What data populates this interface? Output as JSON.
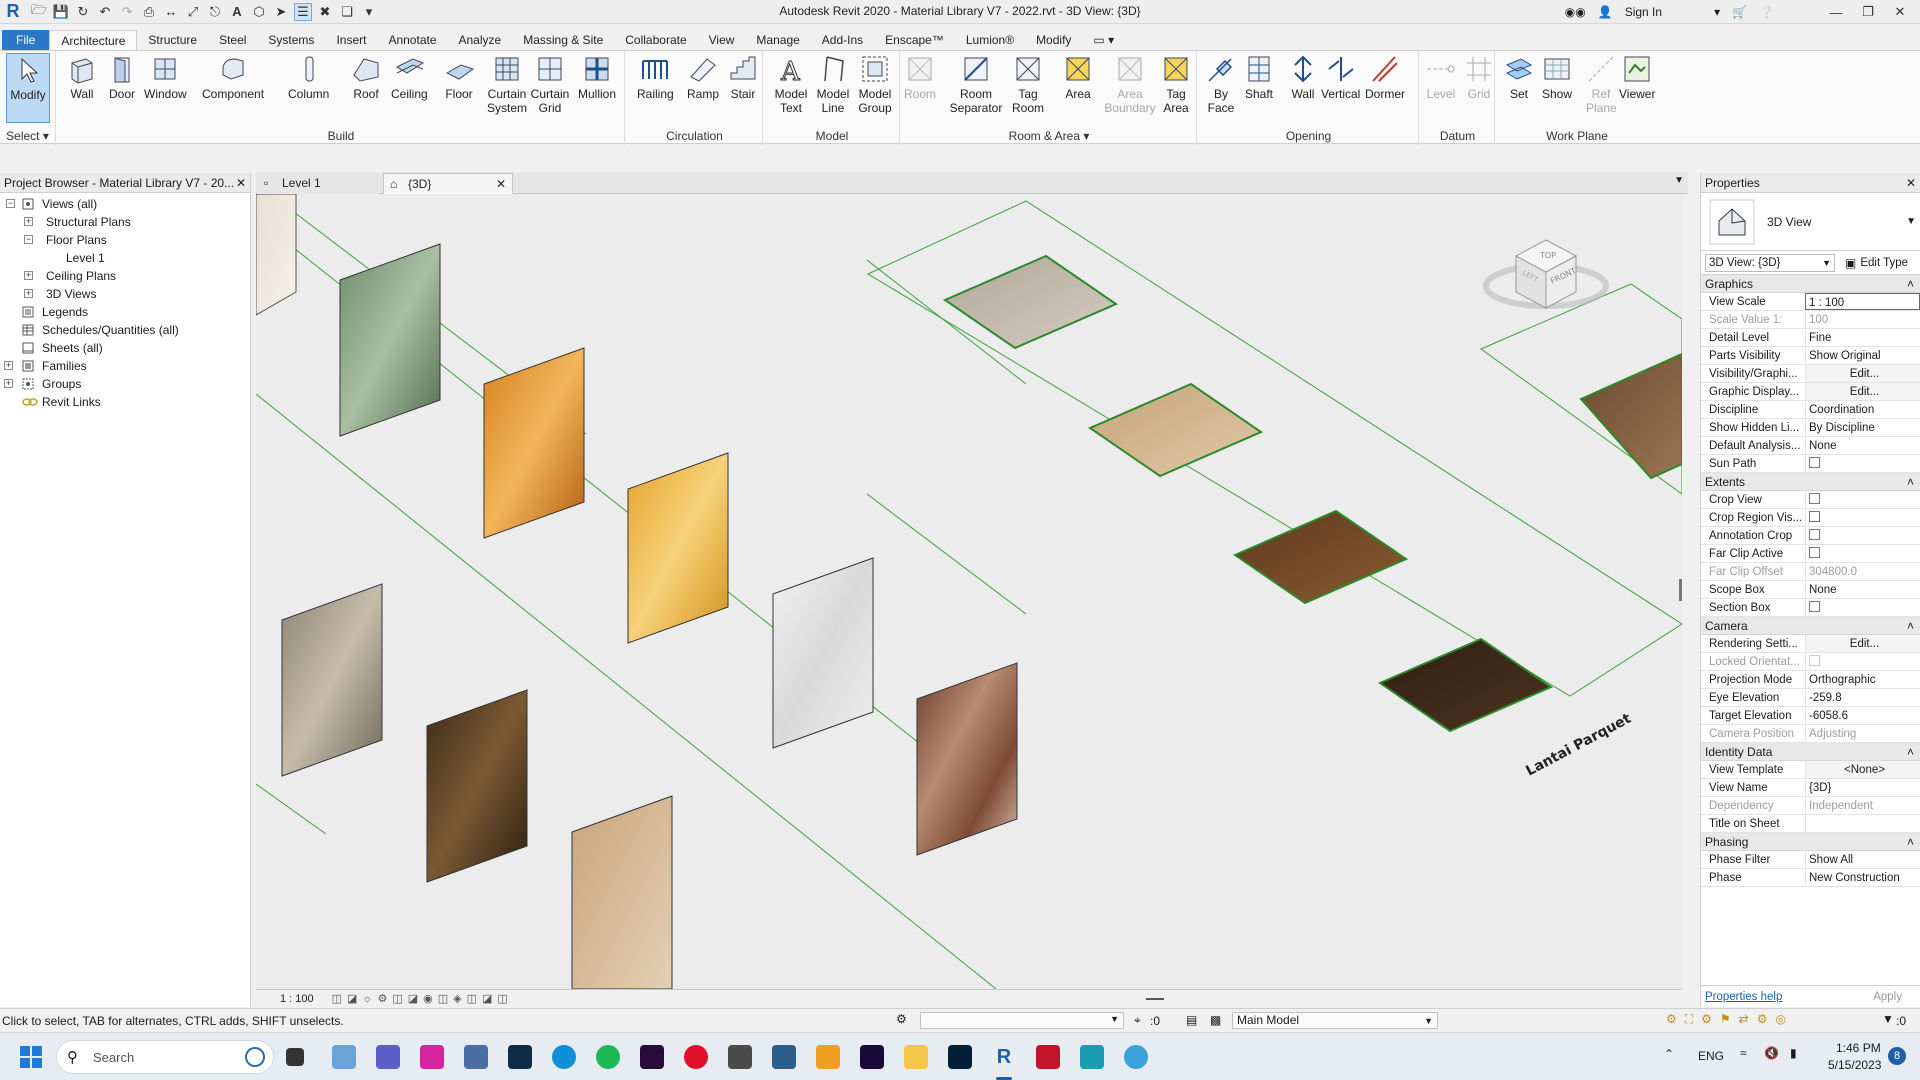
{
  "window": {
    "title": "Autodesk Revit 2020 - Material Library V7 - 2022.rvt - 3D View: {3D}",
    "sign_in": "Sign In"
  },
  "menu_tabs": [
    "File",
    "Architecture",
    "Structure",
    "Steel",
    "Systems",
    "Insert",
    "Annotate",
    "Analyze",
    "Massing & Site",
    "Collaborate",
    "View",
    "Manage",
    "Add-Ins",
    "Enscape™",
    "Lumion®",
    "Modify"
  ],
  "ribbon": {
    "select_label": "Select",
    "modify": "Modify",
    "build": {
      "label": "Build",
      "buttons": [
        "Wall",
        "Door",
        "Window",
        "Component",
        "Column",
        "Roof",
        "Ceiling",
        "Floor",
        "Curtain System",
        "Curtain Grid",
        "Mullion"
      ]
    },
    "circulation": {
      "label": "Circulation",
      "buttons": [
        "Railing",
        "Ramp",
        "Stair"
      ]
    },
    "model": {
      "label": "Model",
      "buttons": [
        "Model Text",
        "Model Line",
        "Model Group"
      ]
    },
    "room_area": {
      "label": "Room & Area",
      "buttons": [
        "Room",
        "Room Separator",
        "Tag Room",
        "Area",
        "Area Boundary",
        "Tag Area"
      ]
    },
    "opening": {
      "label": "Opening",
      "buttons": [
        "By Face",
        "Shaft",
        "Wall",
        "Vertical",
        "Dormer"
      ]
    },
    "datum": {
      "label": "Datum",
      "buttons": [
        "Level",
        "Grid"
      ]
    },
    "work_plane": {
      "label": "Work Plane",
      "buttons": [
        "Set",
        "Show",
        "Ref Plane",
        "Viewer"
      ]
    }
  },
  "project_browser": {
    "title": "Project Browser - Material Library V7 - 20...",
    "items": [
      "Views (all)",
      "Structural Plans",
      "Floor Plans",
      "Level 1",
      "Ceiling Plans",
      "3D Views",
      "Legends",
      "Schedules/Quantities (all)",
      "Sheets (all)",
      "Families",
      "Groups",
      "Revit Links"
    ]
  },
  "view_tabs": [
    "Level 1",
    "{3D}"
  ],
  "canvas": {
    "annotation": "Lantai Parquet",
    "viewcube": {
      "top": "TOP",
      "front": "FRONT",
      "left": "LEFT"
    },
    "scale": "1 : 100"
  },
  "properties": {
    "title": "Properties",
    "type_name": "3D View",
    "instance_selector": "3D View: {3D}",
    "edit_type": "Edit Type",
    "groups": [
      {
        "name": "Graphics",
        "rows": [
          {
            "n": "View Scale",
            "v": "1 : 100"
          },
          {
            "n": "Scale Value    1:",
            "v": "100",
            "dis": true
          },
          {
            "n": "Detail Level",
            "v": "Fine"
          },
          {
            "n": "Parts Visibility",
            "v": "Show Original"
          },
          {
            "n": "Visibility/Graphi...",
            "v": "Edit..."
          },
          {
            "n": "Graphic Display...",
            "v": "Edit..."
          },
          {
            "n": "Discipline",
            "v": "Coordination"
          },
          {
            "n": "Show Hidden Li...",
            "v": "By Discipline"
          },
          {
            "n": "Default Analysis...",
            "v": "None"
          },
          {
            "n": "Sun Path",
            "v": ""
          }
        ]
      },
      {
        "name": "Extents",
        "rows": [
          {
            "n": "Crop View",
            "v": ""
          },
          {
            "n": "Crop Region Vis...",
            "v": ""
          },
          {
            "n": "Annotation Crop",
            "v": ""
          },
          {
            "n": "Far Clip Active",
            "v": ""
          },
          {
            "n": "Far Clip Offset",
            "v": "304800.0",
            "dis": true
          },
          {
            "n": "Scope Box",
            "v": "None"
          },
          {
            "n": "Section Box",
            "v": ""
          }
        ]
      },
      {
        "name": "Camera",
        "rows": [
          {
            "n": "Rendering Setti...",
            "v": "Edit..."
          },
          {
            "n": "Locked Orientat...",
            "v": "",
            "dis": true
          },
          {
            "n": "Projection Mode",
            "v": "Orthographic"
          },
          {
            "n": "Eye Elevation",
            "v": "-259.8"
          },
          {
            "n": "Target Elevation",
            "v": "-6058.6"
          },
          {
            "n": "Camera Position",
            "v": "Adjusting",
            "dis": true
          }
        ]
      },
      {
        "name": "Identity Data",
        "rows": [
          {
            "n": "View Template",
            "v": "<None>"
          },
          {
            "n": "View Name",
            "v": "{3D}"
          },
          {
            "n": "Dependency",
            "v": "Independent",
            "dis": true
          },
          {
            "n": "Title on Sheet",
            "v": ""
          }
        ]
      },
      {
        "name": "Phasing",
        "rows": [
          {
            "n": "Phase Filter",
            "v": "Show All"
          },
          {
            "n": "Phase",
            "v": "New Construction"
          }
        ]
      }
    ],
    "help": "Properties help",
    "apply": "Apply"
  },
  "status": {
    "hint": "Click to select, TAB for alternates, CTRL adds, SHIFT unselects.",
    "zero": ":0",
    "model": "Main Model",
    "filter_count": ":0"
  },
  "taskbar": {
    "search": "Search",
    "lang": "ENG",
    "time": "1:46 PM",
    "date": "5/15/2023",
    "notif": "8"
  }
}
